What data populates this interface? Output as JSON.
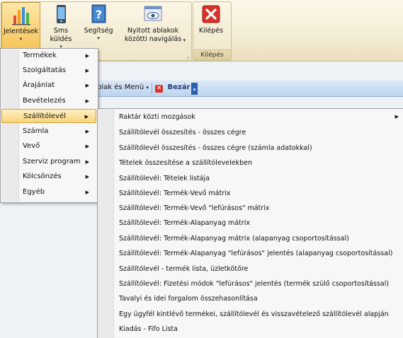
{
  "ribbon": {
    "buttons": [
      {
        "label": "Jelentések",
        "icon": "bar-chart-icon"
      },
      {
        "label": "Sms küldés",
        "icon": "phone-icon"
      },
      {
        "label": "Segítség",
        "icon": "help-book-icon"
      },
      {
        "label": "Nyitott ablakok közötti navigálás",
        "icon": "window-eye-icon"
      },
      {
        "label": "Kilépés",
        "icon": "close-icon"
      }
    ],
    "group_exit_label": "Kilépés"
  },
  "toolstrip": {
    "windows_menu_label": "blak és Menü",
    "close_label": "Bezár"
  },
  "menu": {
    "items": [
      {
        "label": "Termékek"
      },
      {
        "label": "Szolgáltatás"
      },
      {
        "label": "Árajánlat"
      },
      {
        "label": "Bevételezés"
      },
      {
        "label": "Szállítólevél"
      },
      {
        "label": "Számla"
      },
      {
        "label": "Vevő"
      },
      {
        "label": "Szerviz program"
      },
      {
        "label": "Kölcsönzés"
      },
      {
        "label": "Egyéb"
      }
    ],
    "selected": "Szállítólevél"
  },
  "submenu": {
    "items": [
      {
        "label": "Raktár közti mozgások"
      },
      {
        "label": "Szállítólevél összesítés - összes cégre"
      },
      {
        "label": "Szállítólevél összesítés - összes cégre (számla adatokkal)"
      },
      {
        "label": "Tételek összesítése a szállítólevelekben"
      },
      {
        "label": "Szállítólevél: Tételek listája"
      },
      {
        "label": "Szállítólevél: Termék-Vevő mátrix"
      },
      {
        "label": "Szállítólevél: Termék-Vevő \"lefúrásos\" mátrix"
      },
      {
        "label": "Szállítólevél: Termék-Alapanyag mátrix"
      },
      {
        "label": "Szállítólevél: Termék-Alapanyag mátrix (alapanyag csoportosítással)"
      },
      {
        "label": "Szállítólevél: Termék-Alapanyag \"lefúrásos\" jelentés (alapanyag csoportosítással)"
      },
      {
        "label": "Szállítólevél - termék lista, üzletkötőre"
      },
      {
        "label": "Szállítólevél: Fizetési módok \"lefúrásos\" jelentés (termék szülő csoportosítással)"
      },
      {
        "label": "Tavalyi és idei forgalom összehasonlítása"
      },
      {
        "label": "Egy ügyfél kintlévő termékei, szállítólevél és visszavételező szállítólevél alapján"
      },
      {
        "label": "Kiadás - Fifo Lista"
      }
    ]
  }
}
